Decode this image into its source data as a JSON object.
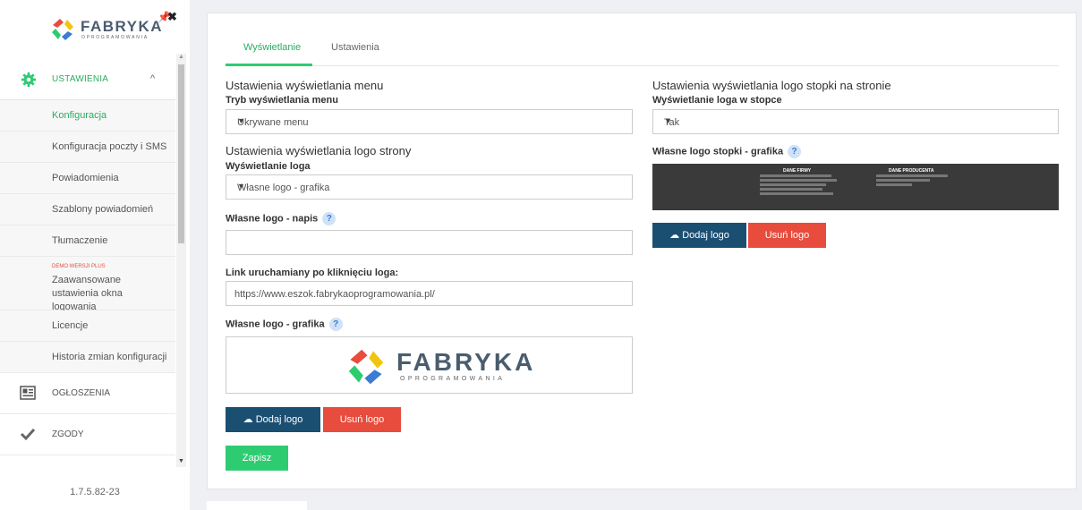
{
  "brand": {
    "name": "FABRYKA",
    "subtitle": "OPROGRAMOWANIA"
  },
  "sidebar": {
    "settings_label": "USTAWIENIA",
    "sub_items": [
      {
        "label": "Konfiguracja",
        "active": true
      },
      {
        "label": "Konfiguracja poczty i SMS"
      },
      {
        "label": "Powiadomienia"
      },
      {
        "label": "Szablony powiadomień"
      },
      {
        "label": "Tłumaczenie"
      }
    ],
    "advanced": {
      "badge": "DEMO WERSJI PLUS",
      "label": "Zaawansowane ustawienia okna logowania"
    },
    "sub_items_2": [
      {
        "label": "Licencje"
      },
      {
        "label": "Historia zmian konfiguracji"
      }
    ],
    "main_items": [
      {
        "label": "OGŁOSZENIA",
        "icon": "newspaper-icon"
      },
      {
        "label": "ZGODY",
        "icon": "check-icon"
      }
    ],
    "version": "1.7.5.82-23"
  },
  "tabs": [
    {
      "label": "Wyświetlanie",
      "active": true
    },
    {
      "label": "Ustawienia"
    }
  ],
  "left": {
    "menu_heading": "Ustawienia wyświetlania menu",
    "menu_mode_label": "Tryb wyświetlania menu",
    "menu_mode_value": "Ukrywane menu",
    "logo_heading": "Ustawienia wyświetlania logo strony",
    "logo_display_label": "Wyświetlanie loga",
    "logo_display_value": "Własne logo - grafika",
    "logo_text_label": "Własne logo - napis",
    "logo_text_value": "",
    "link_label": "Link uruchamiany po kliknięciu loga:",
    "link_value": "https://www.eszok.fabrykaoprogramowania.pl/",
    "logo_graphic_label": "Własne logo - grafika",
    "add_logo": "Dodaj logo",
    "remove_logo": "Usuń logo",
    "save": "Zapisz"
  },
  "right": {
    "footer_heading": "Ustawienia wyświetlania logo stopki na stronie",
    "footer_display_label": "Wyświetlanie loga w stopce",
    "footer_display_value": "Tak",
    "footer_graphic_label": "Własne logo stopki - grafika",
    "footer_col1_title": "DANE FIRMY",
    "footer_col2_title": "DANE PRODUCENTA",
    "add_logo": "Dodaj logo",
    "remove_logo": "Usuń logo"
  },
  "help_glyph": "?",
  "colors": {
    "accent": "#2ecc71",
    "primary_button": "#1b4f72",
    "danger_button": "#e74c3c"
  }
}
